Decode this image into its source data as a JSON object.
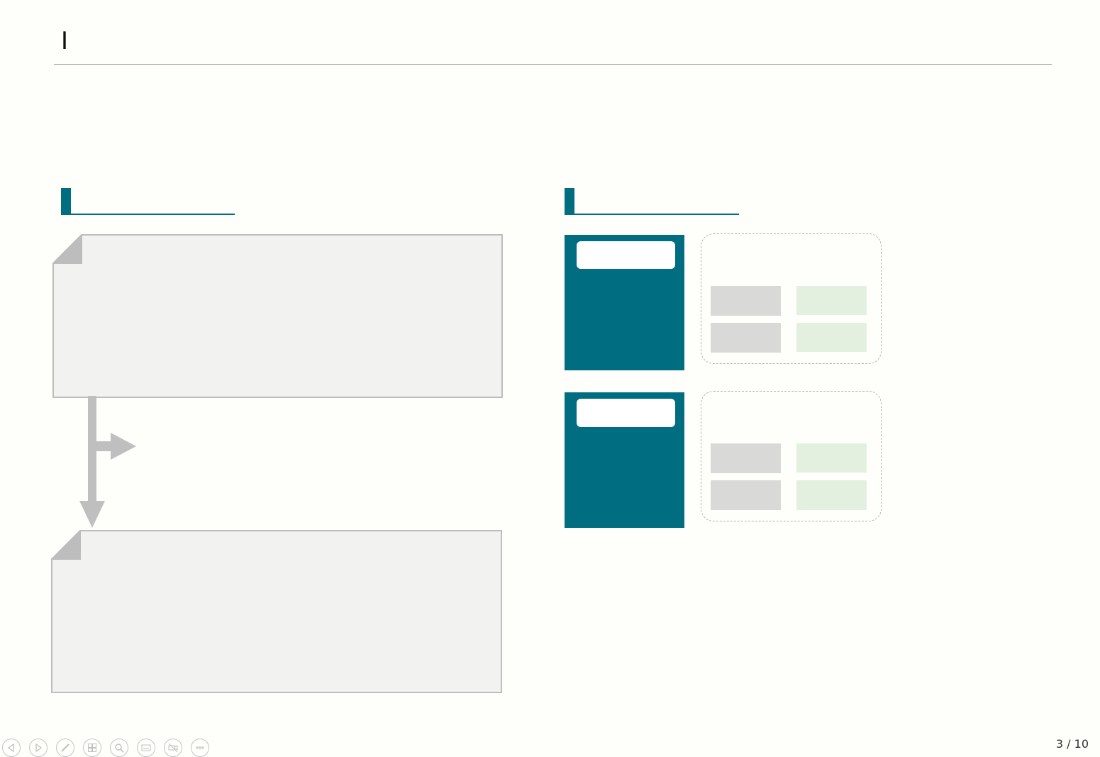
{
  "slide": {
    "title": "I",
    "page_counter": "3 / 10"
  },
  "colors": {
    "accent": "#006d80",
    "note_fill": "#f2f2f1",
    "note_border": "#bdbdbd",
    "grey_cell": "#d9d9d8",
    "green_cell": "#e4f0df",
    "background": "#fefefb"
  },
  "toolbar": {
    "buttons": [
      {
        "icon": "previous-slide-icon"
      },
      {
        "icon": "next-slide-icon"
      },
      {
        "icon": "pen-icon"
      },
      {
        "icon": "slide-overview-icon"
      },
      {
        "icon": "zoom-icon"
      },
      {
        "icon": "subtitles-icon"
      },
      {
        "icon": "camera-off-icon"
      },
      {
        "icon": "more-options-icon"
      }
    ]
  }
}
